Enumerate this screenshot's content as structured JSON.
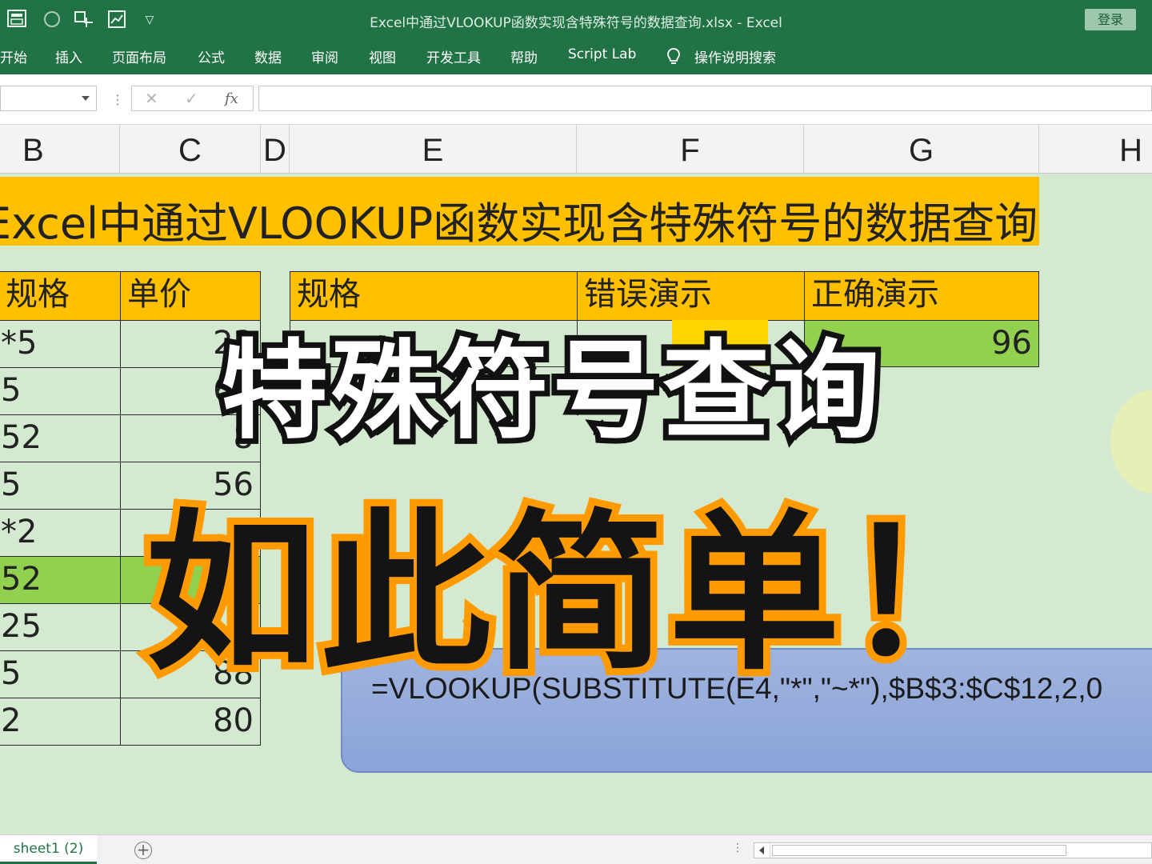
{
  "window": {
    "title": "Excel中通过VLOOKUP函数实现含特殊符号的数据查询.xlsx  -  Excel",
    "login_label": "登录"
  },
  "ribbon": {
    "tabs": [
      "开始",
      "插入",
      "页面布局",
      "公式",
      "数据",
      "审阅",
      "视图",
      "开发工具",
      "帮助",
      "Script Lab",
      "操作说明搜索"
    ]
  },
  "formula_bar": {
    "cancel": "✕",
    "enter": "✓",
    "fx": "fx",
    "value": ""
  },
  "columns": [
    "B",
    "C",
    "D",
    "E",
    "F",
    "G",
    "H"
  ],
  "banner": "Excel中通过VLOOKUP函数实现含特殊符号的数据查询",
  "left_table": {
    "headers": [
      "规格",
      "单价"
    ],
    "rows": [
      {
        "spec": "*5",
        "price": "23"
      },
      {
        "spec": "5",
        "price": "63"
      },
      {
        "spec": "52",
        "price": "8"
      },
      {
        "spec": "5",
        "price": "56"
      },
      {
        "spec": "*2",
        "price": ""
      },
      {
        "spec": "52",
        "price": ""
      },
      {
        "spec": "25",
        "price": ""
      },
      {
        "spec": "5",
        "price": "88"
      },
      {
        "spec": "2",
        "price": "80"
      }
    ]
  },
  "right_table": {
    "headers": [
      "规格",
      "错误演示",
      "正确演示"
    ],
    "row": {
      "spec": "",
      "wrong": "",
      "correct": "96"
    }
  },
  "formula_box": "=VLOOKUP(SUBSTITUTE(E4,\"*\",\"~*\"),$B$3:$C$12,2,0",
  "overlay": {
    "line1": "特殊符号查询",
    "line2": "如此简单！"
  },
  "sheet_tabs": {
    "active": "sheet1 (2)",
    "add": "+"
  },
  "colors": {
    "excel_green": "#217346",
    "header_yellow": "#ffc000",
    "sheet_bg": "#d4ead0",
    "highlight_green": "#92d050",
    "overlay_orange": "#ff9a00"
  }
}
